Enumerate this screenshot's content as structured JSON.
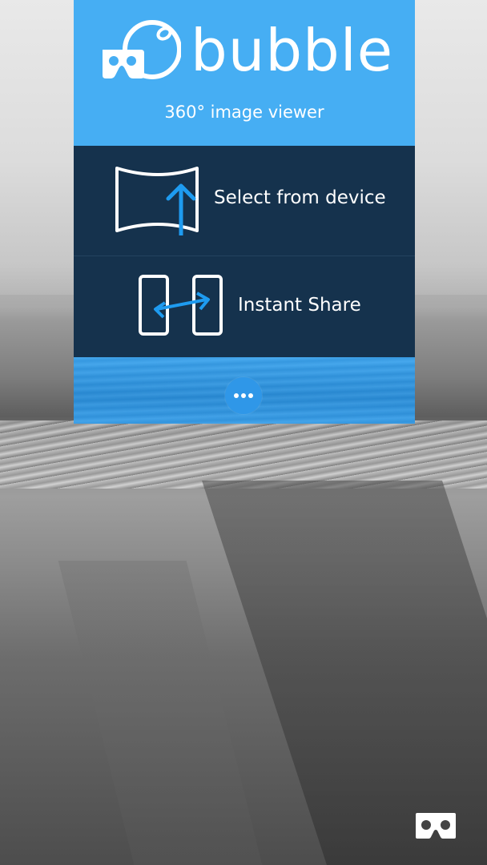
{
  "app": {
    "brand_name": "bubble",
    "tagline": "360° image viewer",
    "logo_icon": "bubble-vr-headset-icon"
  },
  "menu": {
    "items": [
      {
        "label": "Select from device",
        "icon": "panorama-upload-icon"
      },
      {
        "label": "Instant Share",
        "icon": "device-transfer-icon"
      }
    ]
  },
  "footer": {
    "more_icon": "more-dots-icon"
  },
  "overlay": {
    "vr_mode_icon": "vr-cardboard-icon"
  },
  "colors": {
    "header_blue": "#46aef3",
    "menu_navy": "#15324d",
    "accent_blue": "#1e9bf0",
    "text": "#ffffff"
  }
}
